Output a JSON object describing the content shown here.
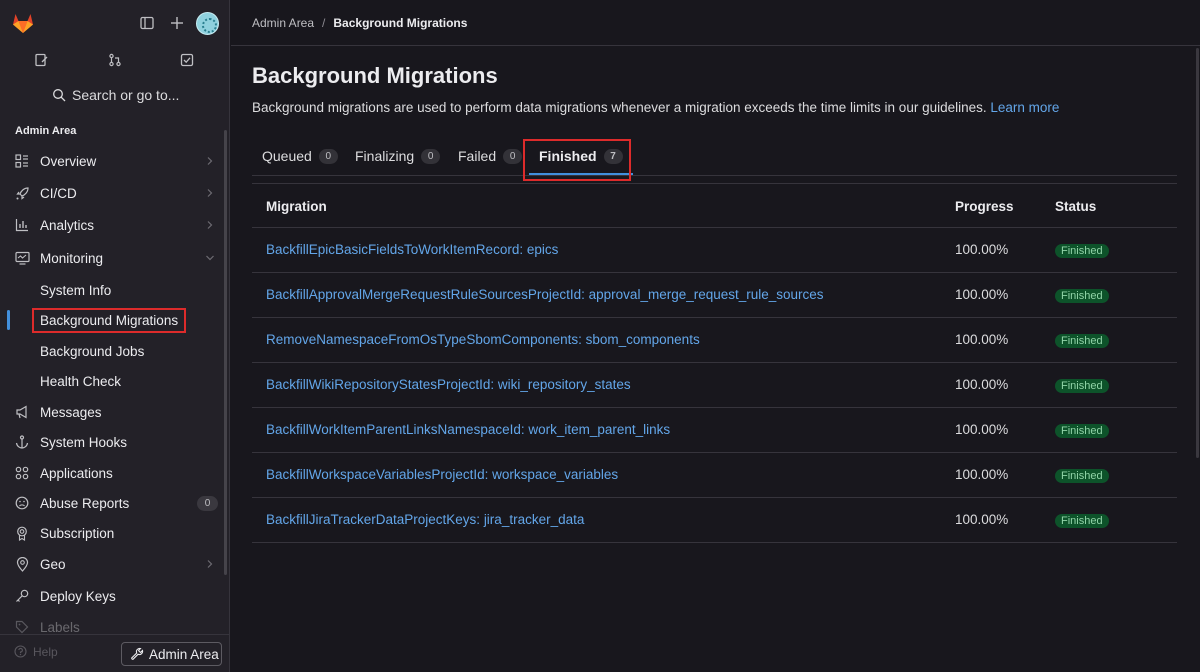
{
  "sidebar": {
    "search_label": "Search or go to...",
    "section_title": "Admin Area",
    "items": [
      {
        "label": "Overview"
      },
      {
        "label": "CI/CD"
      },
      {
        "label": "Analytics"
      },
      {
        "label": "Monitoring"
      },
      {
        "label": "System Info"
      },
      {
        "label": "Background Migrations"
      },
      {
        "label": "Background Jobs"
      },
      {
        "label": "Health Check"
      },
      {
        "label": "Messages"
      },
      {
        "label": "System Hooks"
      },
      {
        "label": "Applications"
      },
      {
        "label": "Abuse Reports",
        "count": "0"
      },
      {
        "label": "Subscription"
      },
      {
        "label": "Geo"
      },
      {
        "label": "Deploy Keys"
      },
      {
        "label": "Labels"
      }
    ],
    "help_label": "Help",
    "admin_button_label": "Admin Area"
  },
  "breadcrumb": {
    "parent": "Admin Area",
    "separator": "/",
    "current": "Background Migrations"
  },
  "page": {
    "title": "Background Migrations",
    "description": "Background migrations are used to perform data migrations whenever a migration exceeds the time limits in our guidelines.",
    "learn_more": "Learn more"
  },
  "tabs": [
    {
      "label": "Queued",
      "count": "0"
    },
    {
      "label": "Finalizing",
      "count": "0"
    },
    {
      "label": "Failed",
      "count": "0"
    },
    {
      "label": "Finished",
      "count": "7",
      "active": true
    }
  ],
  "table": {
    "headers": {
      "migration": "Migration",
      "progress": "Progress",
      "status": "Status"
    },
    "rows": [
      {
        "migration": "BackfillEpicBasicFieldsToWorkItemRecord: epics",
        "progress": "100.00%",
        "status": "Finished"
      },
      {
        "migration": "BackfillApprovalMergeRequestRuleSourcesProjectId: approval_merge_request_rule_sources",
        "progress": "100.00%",
        "status": "Finished"
      },
      {
        "migration": "RemoveNamespaceFromOsTypeSbomComponents: sbom_components",
        "progress": "100.00%",
        "status": "Finished"
      },
      {
        "migration": "BackfillWikiRepositoryStatesProjectId: wiki_repository_states",
        "progress": "100.00%",
        "status": "Finished"
      },
      {
        "migration": "BackfillWorkItemParentLinksNamespaceId: work_item_parent_links",
        "progress": "100.00%",
        "status": "Finished"
      },
      {
        "migration": "BackfillWorkspaceVariablesProjectId: workspace_variables",
        "progress": "100.00%",
        "status": "Finished"
      },
      {
        "migration": "BackfillJiraTrackerDataProjectKeys: jira_tracker_data",
        "progress": "100.00%",
        "status": "Finished"
      }
    ]
  },
  "colors": {
    "accent": "#428fdc",
    "link": "#63a6e9",
    "highlight": "#dd2b2b",
    "badge_bg": "#0d532a",
    "badge_text": "#91d4a8"
  },
  "icons": [
    "gitlab-logo-icon",
    "sidebar-toggle-icon",
    "plus-icon",
    "issues-icon",
    "merge-request-icon",
    "todo-icon",
    "search-icon"
  ]
}
